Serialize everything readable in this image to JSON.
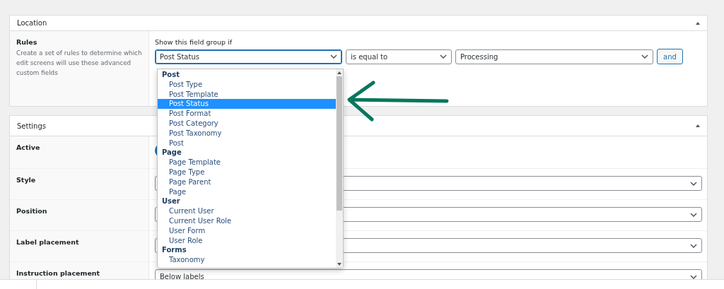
{
  "location": {
    "title": "Location",
    "rules_label": "Rules",
    "rules_description": "Create a set of rules to determine which edit screens will use these advanced custom fields",
    "heading": "Show this field group if",
    "rule": {
      "param": "Post Status",
      "operator": "is equal to",
      "value": "Processing"
    },
    "and_button": "and"
  },
  "dropdown": {
    "groups": [
      {
        "label": "Post",
        "options": [
          {
            "label": "Post Type",
            "selected": false
          },
          {
            "label": "Post Template",
            "selected": false
          },
          {
            "label": "Post Status",
            "selected": true
          },
          {
            "label": "Post Format",
            "selected": false
          },
          {
            "label": "Post Category",
            "selected": false
          },
          {
            "label": "Post Taxonomy",
            "selected": false
          },
          {
            "label": "Post",
            "selected": false
          }
        ]
      },
      {
        "label": "Page",
        "options": [
          {
            "label": "Page Template",
            "selected": false
          },
          {
            "label": "Page Type",
            "selected": false
          },
          {
            "label": "Page Parent",
            "selected": false
          },
          {
            "label": "Page",
            "selected": false
          }
        ]
      },
      {
        "label": "User",
        "options": [
          {
            "label": "Current User",
            "selected": false
          },
          {
            "label": "Current User Role",
            "selected": false
          },
          {
            "label": "User Form",
            "selected": false
          },
          {
            "label": "User Role",
            "selected": false
          }
        ]
      },
      {
        "label": "Forms",
        "options": [
          {
            "label": "Taxonomy",
            "selected": false
          }
        ]
      }
    ]
  },
  "settings": {
    "title": "Settings",
    "rows": [
      {
        "label": "Active",
        "kind": "toggle",
        "on": true
      },
      {
        "label": "Style",
        "kind": "select"
      },
      {
        "label": "Position",
        "kind": "select"
      },
      {
        "label": "Label placement",
        "kind": "select"
      },
      {
        "label": "Instruction placement",
        "kind": "select",
        "value": "Below labels"
      }
    ]
  }
}
